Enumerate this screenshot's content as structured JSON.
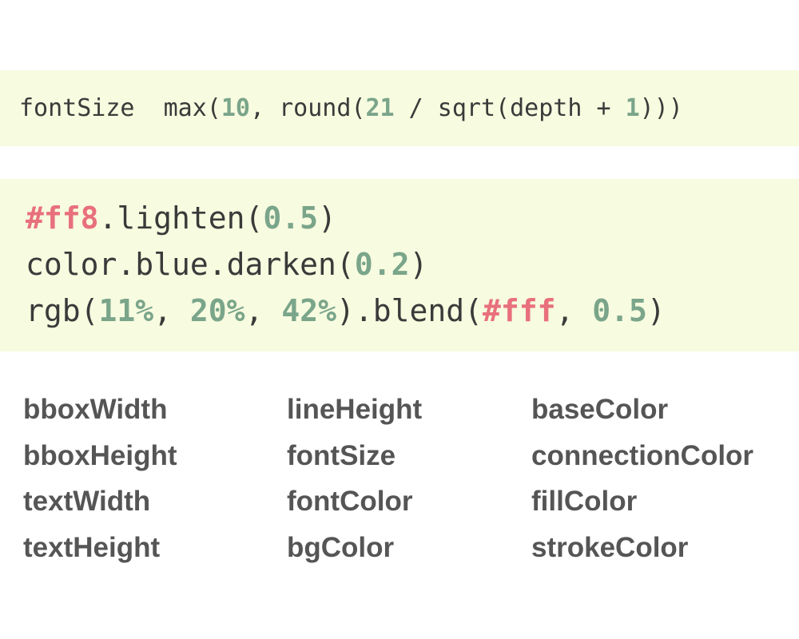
{
  "code_block_1": {
    "tokens": [
      {
        "text": "fontSize  max(",
        "kind": "plain"
      },
      {
        "text": "10",
        "kind": "num"
      },
      {
        "text": ", round(",
        "kind": "plain"
      },
      {
        "text": "21",
        "kind": "num"
      },
      {
        "text": " / sqrt(depth + ",
        "kind": "plain"
      },
      {
        "text": "1",
        "kind": "num"
      },
      {
        "text": ")))",
        "kind": "plain"
      }
    ]
  },
  "code_block_2": {
    "lines": [
      [
        {
          "text": "#ff8",
          "kind": "hex"
        },
        {
          "text": ".lighten(",
          "kind": "plain"
        },
        {
          "text": "0.5",
          "kind": "num"
        },
        {
          "text": ")",
          "kind": "plain"
        }
      ],
      [
        {
          "text": "color.blue.darken(",
          "kind": "plain"
        },
        {
          "text": "0.2",
          "kind": "num"
        },
        {
          "text": ")",
          "kind": "plain"
        }
      ],
      [
        {
          "text": "rgb(",
          "kind": "plain"
        },
        {
          "text": "11%",
          "kind": "num"
        },
        {
          "text": ", ",
          "kind": "plain"
        },
        {
          "text": "20%",
          "kind": "num"
        },
        {
          "text": ", ",
          "kind": "plain"
        },
        {
          "text": "42%",
          "kind": "num"
        },
        {
          "text": ").blend(",
          "kind": "plain"
        },
        {
          "text": "#fff",
          "kind": "hex"
        },
        {
          "text": ", ",
          "kind": "plain"
        },
        {
          "text": "0.5",
          "kind": "num"
        },
        {
          "text": ")",
          "kind": "plain"
        }
      ]
    ]
  },
  "variables": {
    "columns": [
      [
        "bboxWidth",
        "bboxHeight",
        "textWidth",
        "textHeight"
      ],
      [
        "lineHeight",
        "fontSize",
        "fontColor",
        "bgColor"
      ],
      [
        "baseColor",
        "connectionColor",
        "fillColor",
        "strokeColor"
      ]
    ]
  },
  "colors": {
    "code_background": "#f7fbdf",
    "number_token": "#7aa58a",
    "hex_token": "#e8707c",
    "code_text": "#3a3a3a",
    "variable_text": "#555555"
  }
}
